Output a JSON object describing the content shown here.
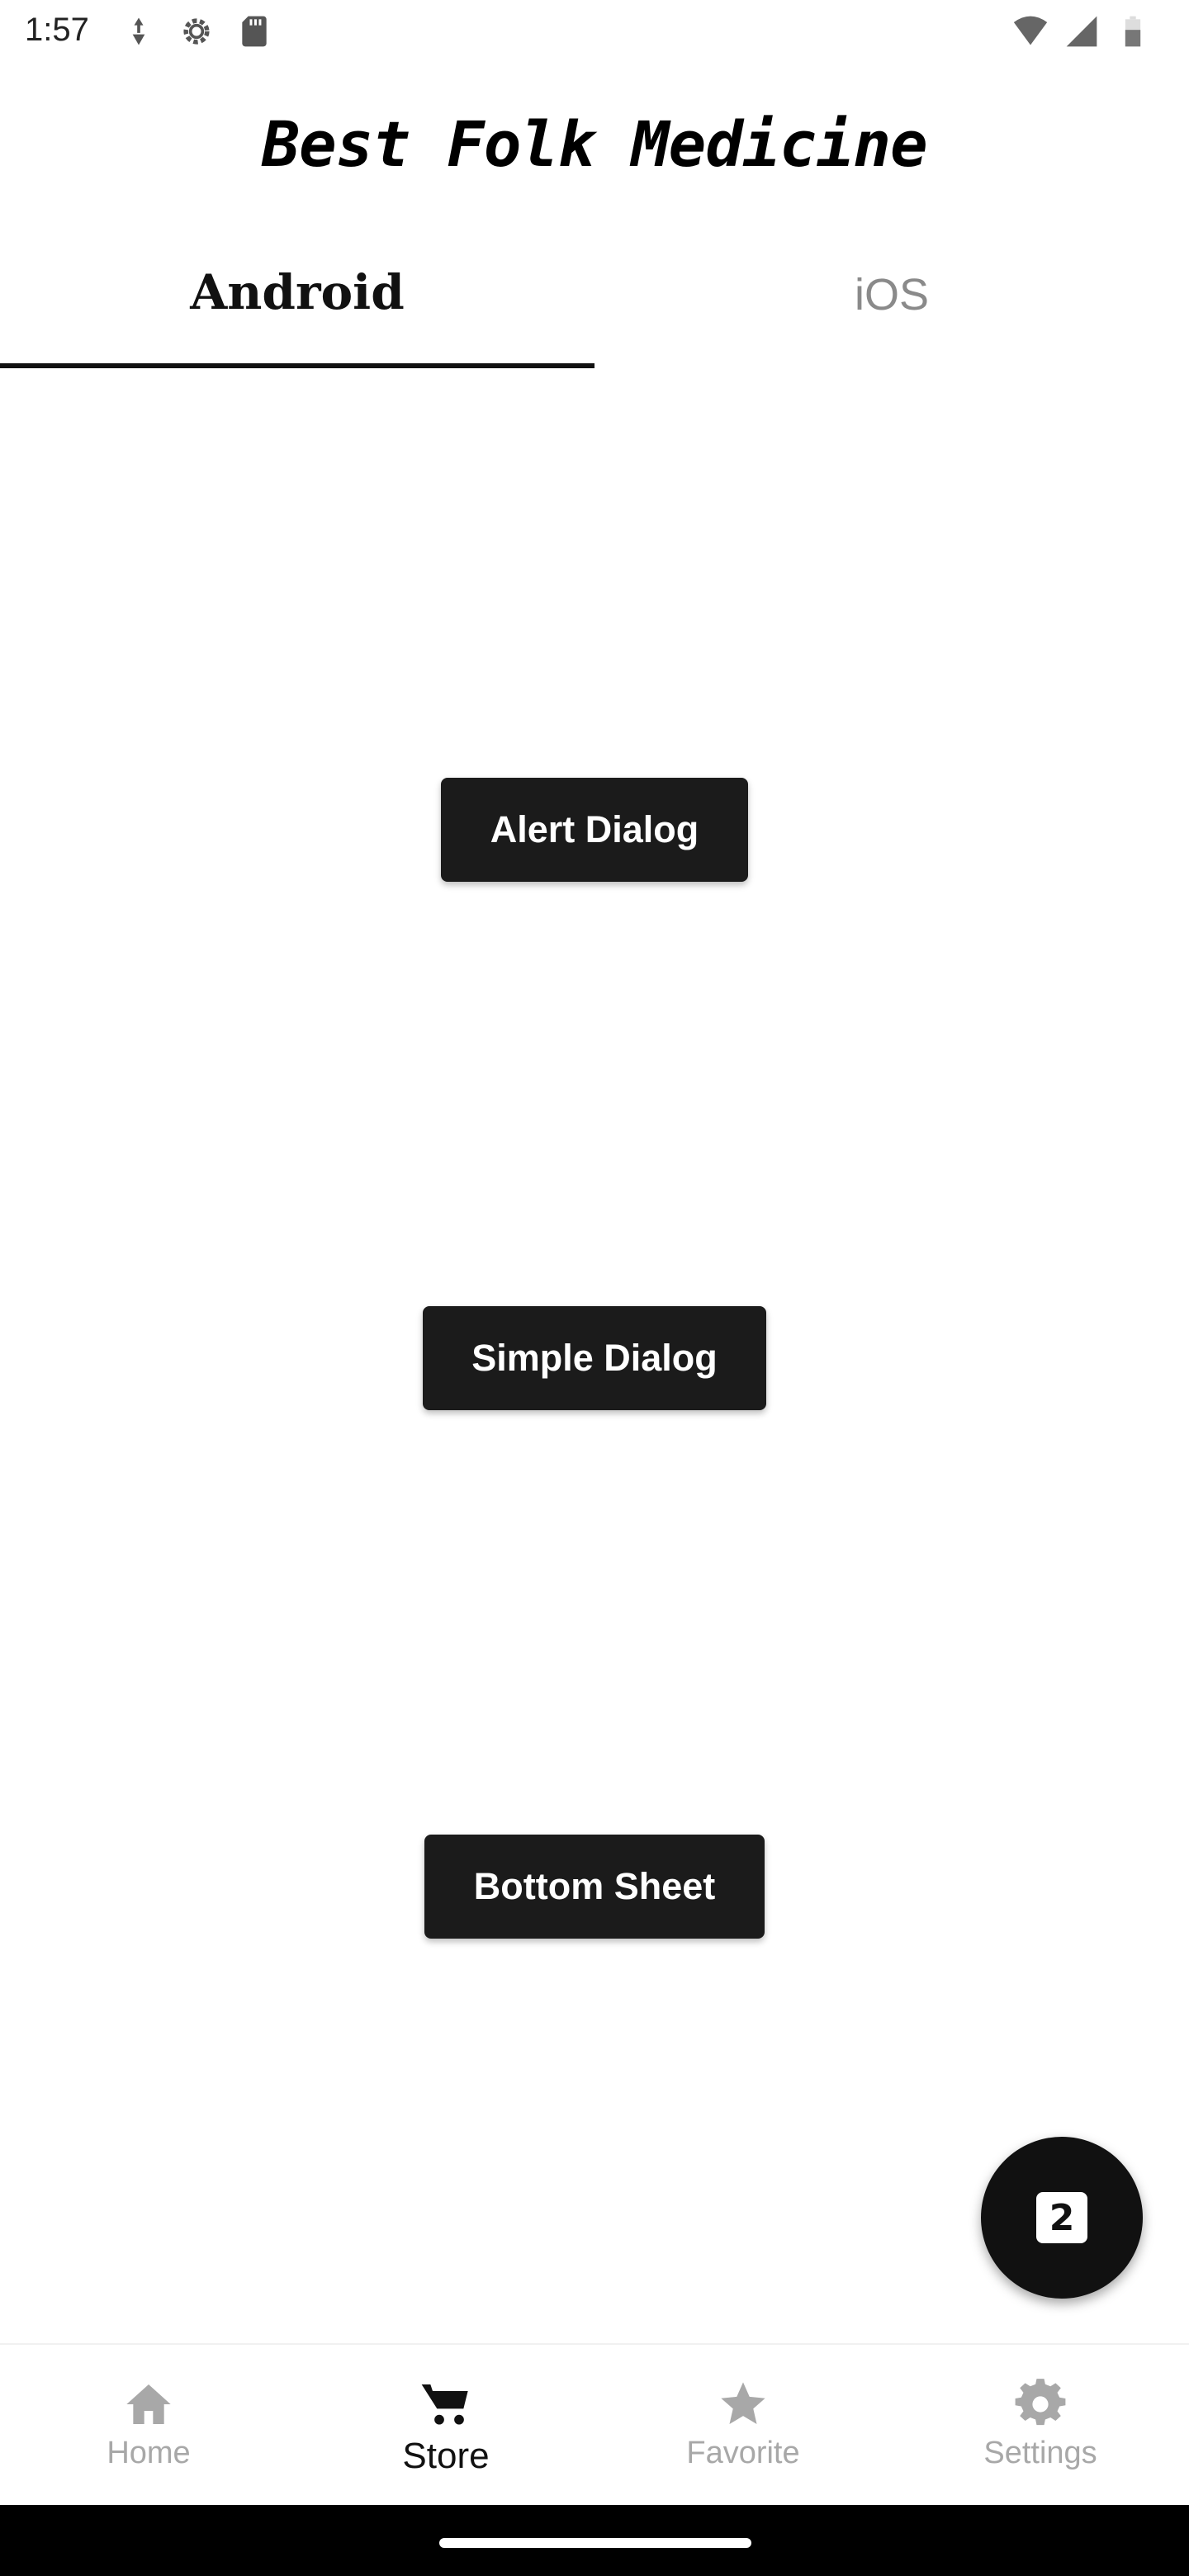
{
  "status_bar": {
    "time": "1:57",
    "left_icons": [
      "data-saver-icon",
      "settings-gear-icon",
      "sd-card-icon"
    ],
    "right_icons": [
      "wifi-icon",
      "cell-signal-icon",
      "battery-icon"
    ]
  },
  "app_bar": {
    "title": "Best Folk Medicine"
  },
  "tabs": [
    {
      "label": "Android",
      "active": true
    },
    {
      "label": "iOS",
      "active": false
    }
  ],
  "buttons": {
    "alert_dialog": "Alert Dialog",
    "simple_dialog": "Simple Dialog",
    "bottom_sheet": "Bottom Sheet"
  },
  "fab": {
    "icon": "looks-two-icon",
    "badge_text": "2"
  },
  "bottom_nav": [
    {
      "label": "Home",
      "icon": "home-icon",
      "active": false
    },
    {
      "label": "Store",
      "icon": "cart-icon",
      "active": true
    },
    {
      "label": "Favorite",
      "icon": "star-icon",
      "active": false
    },
    {
      "label": "Settings",
      "icon": "gear-icon",
      "active": false
    }
  ],
  "colors": {
    "primary": "#111111",
    "inactive": "#a8a8a8",
    "background": "#ffffff"
  }
}
